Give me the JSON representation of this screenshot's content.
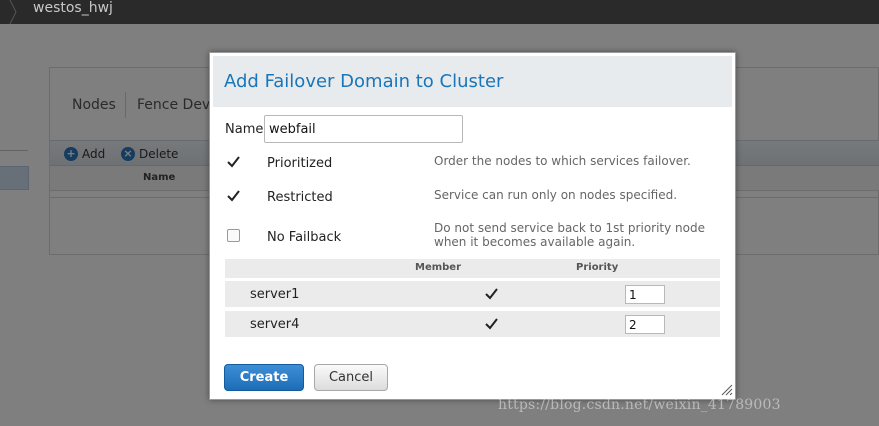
{
  "app": {
    "breadcrumb": "westos_hwj"
  },
  "background": {
    "tabs": [
      {
        "label": "Nodes"
      },
      {
        "label": "Fence Dev"
      }
    ],
    "toolbar": {
      "add_label": "Add",
      "delete_label": "Delete"
    },
    "table": {
      "name_header": "Name"
    }
  },
  "dialog": {
    "title": "Add Failover Domain to Cluster",
    "name_label": "Name",
    "name_value": "webfail",
    "options": [
      {
        "label": "Prioritized",
        "checked": true,
        "description": "Order the nodes to which services failover."
      },
      {
        "label": "Restricted",
        "checked": true,
        "description": "Service can run only on nodes specified."
      },
      {
        "label": "No Failback",
        "checked": false,
        "description": "Do not send service back to 1st priority node when it becomes available again."
      }
    ],
    "nodes_table": {
      "member_header": "Member",
      "priority_header": "Priority",
      "rows": [
        {
          "name": "server1",
          "member": true,
          "priority": "1"
        },
        {
          "name": "server4",
          "member": true,
          "priority": "2"
        }
      ]
    },
    "create_label": "Create",
    "cancel_label": "Cancel"
  },
  "watermark": "https://blog.csdn.net/weixin_41789003",
  "colors": {
    "title_blue": "#1a76b8",
    "primary_button": "#2a7ac4",
    "topbar": "#2a2a2a"
  }
}
